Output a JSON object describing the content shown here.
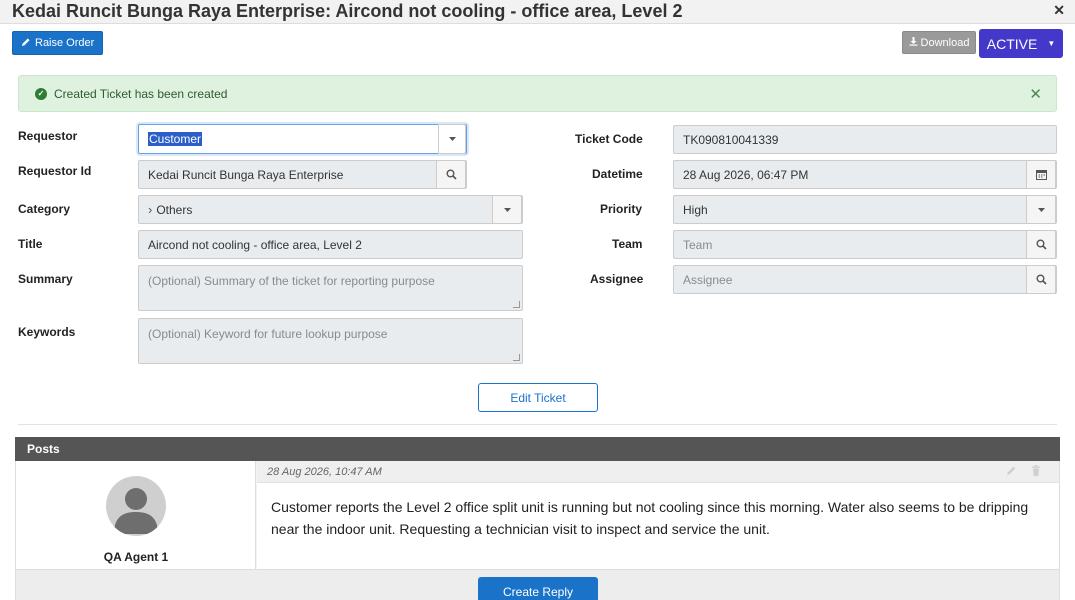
{
  "window": {
    "title": "Kedai Runcit Bunga Raya Enterprise: Aircond not cooling - office area, Level 2",
    "close_glyph": "✕"
  },
  "toolbar": {
    "raise_order": "Raise Order",
    "download": "Download",
    "status": "ACTIVE"
  },
  "alert": {
    "message": "Created Ticket has been created",
    "dismiss_glyph": "✕"
  },
  "form": {
    "requestor": {
      "label": "Requestor",
      "value": "Customer"
    },
    "requestor_id": {
      "label": "Requestor Id",
      "value": "Kedai Runcit Bunga Raya Enterprise"
    },
    "category": {
      "label": "Category",
      "value": "Others"
    },
    "title": {
      "label": "Title",
      "value": "Aircond not cooling - office area, Level 2"
    },
    "summary": {
      "label": "Summary",
      "placeholder": "(Optional) Summary of the ticket for reporting purpose"
    },
    "keywords": {
      "label": "Keywords",
      "placeholder": "(Optional) Keyword for future lookup purpose"
    },
    "ticket_code": {
      "label": "Ticket Code",
      "value": "TK090810041339"
    },
    "datetime": {
      "label": "Datetime",
      "value": "28 Aug 2026, 06:47 PM"
    },
    "priority": {
      "label": "Priority",
      "value": "High"
    },
    "team": {
      "label": "Team",
      "placeholder": "Team"
    },
    "assignee": {
      "label": "Assignee",
      "placeholder": "Assignee"
    },
    "edit_button": "Edit Ticket"
  },
  "posts": {
    "heading": "Posts",
    "items": [
      {
        "author": "QA Agent 1",
        "timestamp": "28 Aug 2026, 10:47 AM",
        "text": "Customer reports the Level 2 office split unit is running but not cooling since this morning. Water also seems to be dripping near the indoor unit. Requesting a technician visit to inspect and service the unit."
      }
    ],
    "reply_button": "Create Reply"
  },
  "icons": {
    "pencil": "pencil-icon",
    "download": "download-icon",
    "caret": "caret-down-icon",
    "check": "check-circle-icon",
    "search": "search-icon",
    "calendar": "calendar-icon",
    "chevron": "chevron-right-icon",
    "trash": "trash-icon",
    "avatar": "user-avatar-icon"
  },
  "colors": {
    "primary": "#1a73c9",
    "status": "#4338ca",
    "success_bg": "#dff2e0",
    "posts_header": "#555555"
  }
}
